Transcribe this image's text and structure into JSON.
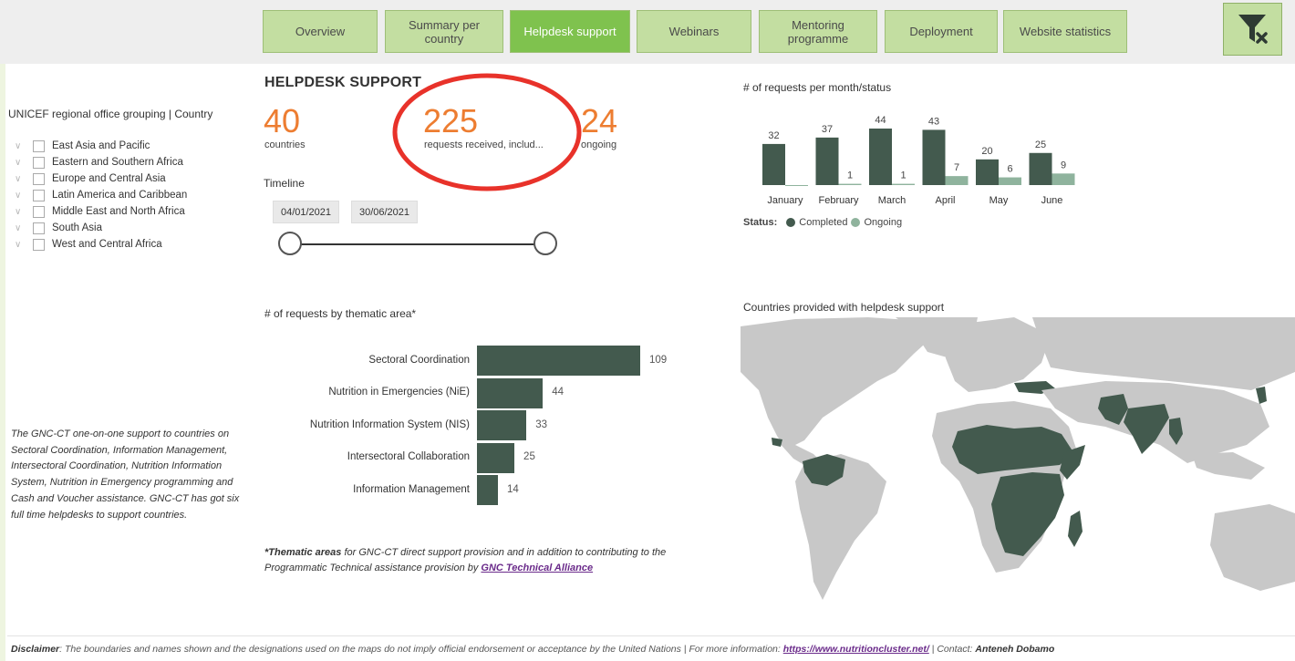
{
  "nav": {
    "tabs": [
      {
        "label": "Overview",
        "active": false
      },
      {
        "label": "Summary per country",
        "active": false
      },
      {
        "label": "Helpdesk support",
        "active": true
      },
      {
        "label": "Webinars",
        "active": false
      },
      {
        "label": "Mentoring programme",
        "active": false
      },
      {
        "label": "Deployment",
        "active": false
      },
      {
        "label": "Website statistics",
        "active": false
      }
    ],
    "clear_filter_icon": "funnel-clear-icon"
  },
  "slicer": {
    "title": "UNICEF regional office grouping | Country",
    "items": [
      "East Asia and Pacific",
      "Eastern and Southern Africa",
      "Europe and Central Asia",
      "Latin America and Caribbean",
      "Middle East and North Africa",
      "South Asia",
      "West and Central Africa"
    ]
  },
  "left_note": "The GNC-CT one-on-one support to countries on Sectoral Coordination, Information Management, Intersectoral Coordination, Nutrition Information System, Nutrition in Emergency programming and Cash and Voucher assistance. GNC-CT has got six full time helpdesks to support countries.",
  "helpdesk": {
    "title": "HELPDESK SUPPORT",
    "kpis": [
      {
        "value": "40",
        "label": "countries"
      },
      {
        "value": "225",
        "label": "requests received, includ..."
      },
      {
        "value": "24",
        "label": "ongoing"
      }
    ],
    "timeline_label": "Timeline",
    "date_start": "04/01/2021",
    "date_end": "30/06/2021"
  },
  "thematic": {
    "title": "# of requests by thematic area*",
    "note_bold": "*Thematic areas",
    "note_text": " for GNC-CT direct support provision and in addition to contributing to the Programmatic Technical assistance provision by ",
    "note_link": "GNC Technical Alliance"
  },
  "monthly": {
    "title": "# of requests per month/status",
    "legend_label": "Status:",
    "legend_completed": "Completed",
    "legend_ongoing": "Ongoing"
  },
  "map": {
    "title": "Countries provided with helpdesk support"
  },
  "footer": {
    "disclaimer_bold": "Disclaimer",
    "disclaimer_text": ": The boundaries and names shown and the designations used on the maps do not imply official endorsement or acceptance by the United Nations | For more information: ",
    "link": "https://www.nutritioncluster.net/",
    "contact_prefix": " | Contact: ",
    "contact_name": "Anteneh Dobamo"
  },
  "colors": {
    "accent_orange": "#ed7d31",
    "completed": "#435a4e",
    "ongoing": "#8fb39d",
    "tab": "#c3dea1",
    "tab_active": "#7fc24e",
    "highlight": "#e8322a"
  },
  "chart_data": [
    {
      "type": "bar",
      "orientation": "horizontal",
      "title": "# of requests by thematic area*",
      "categories": [
        "Sectoral Coordination",
        "Nutrition in Emergencies (NiE)",
        "Nutrition Information System (NIS)",
        "Intersectoral Collaboration",
        "Information Management"
      ],
      "values": [
        109,
        44,
        33,
        25,
        14
      ]
    },
    {
      "type": "bar",
      "title": "# of requests per month/status",
      "categories": [
        "January",
        "February",
        "March",
        "April",
        "May",
        "June"
      ],
      "series": [
        {
          "name": "Completed",
          "values": [
            32,
            37,
            44,
            43,
            20,
            25
          ]
        },
        {
          "name": "Ongoing",
          "values": [
            0,
            1,
            1,
            7,
            6,
            9
          ]
        }
      ],
      "legend": "bottom-left"
    }
  ]
}
